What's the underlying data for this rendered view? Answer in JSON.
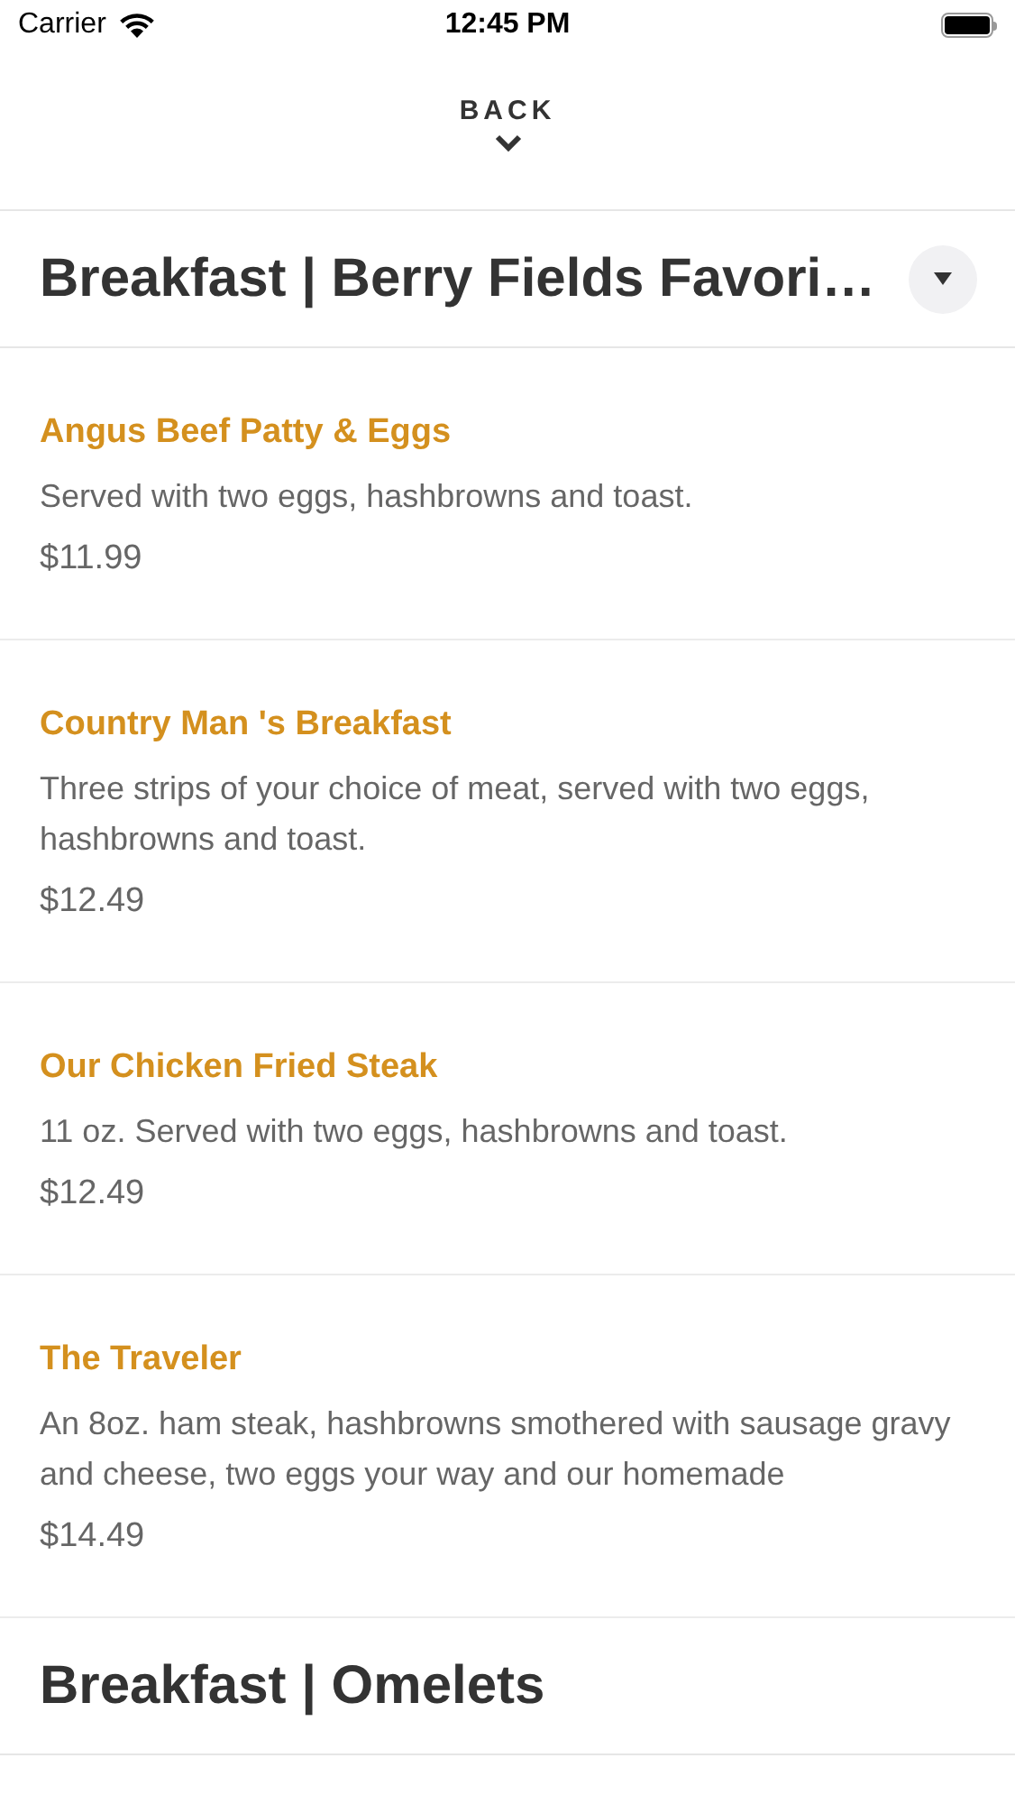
{
  "status_bar": {
    "carrier": "Carrier",
    "time": "12:45 PM"
  },
  "back": {
    "label": "BACK"
  },
  "sections": [
    {
      "title": "Breakfast | Berry Fields Favori…",
      "expanded": true,
      "items": [
        {
          "name": "Angus Beef Patty & Eggs",
          "description": "Served with two eggs, hashbrowns and toast.",
          "price": "$11.99"
        },
        {
          "name": "Country Man 's Breakfast",
          "description": "Three strips of your choice of meat, served with two eggs, hashbrowns and toast.",
          "price": "$12.49"
        },
        {
          "name": "Our Chicken Fried Steak",
          "description": "11 oz. Served with two eggs, hashbrowns and toast.",
          "price": "$12.49"
        },
        {
          "name": "The Traveler",
          "description": "An 8oz. ham steak, hashbrowns smothered with sausage gravy and cheese, two eggs your way and our homemade",
          "price": "$14.49"
        }
      ]
    },
    {
      "title": "Breakfast | Omelets",
      "expanded": false
    }
  ]
}
